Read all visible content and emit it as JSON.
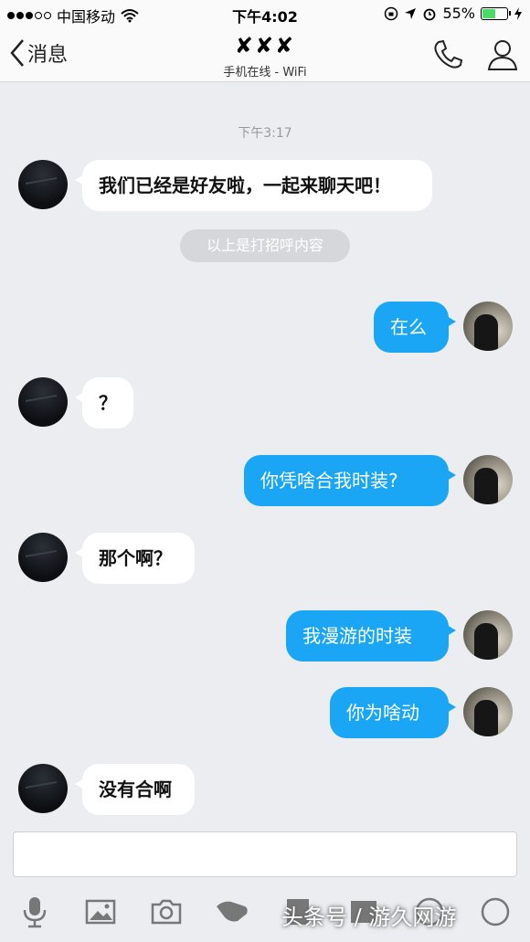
{
  "status_bar": {
    "carrier": "中国移动",
    "time": "下午4:02",
    "battery_percent": "55%",
    "battery_level": 0.55
  },
  "nav": {
    "back_label": "消息",
    "contact_name": "✘✘✘",
    "contact_status": "手机在线 - WiFi"
  },
  "chat": {
    "timestamp": "下午3:17",
    "system_notice": "以上是打招呼内容",
    "messages": [
      {
        "side": "in",
        "text": "我们已经是好友啦，一起来聊天吧！"
      },
      {
        "side": "out",
        "text": "在么"
      },
      {
        "side": "in",
        "text": "？"
      },
      {
        "side": "out",
        "text": "你凭啥合我时装?"
      },
      {
        "side": "in",
        "text": "那个啊？"
      },
      {
        "side": "out",
        "text": "我漫游的时装"
      },
      {
        "side": "out",
        "text": "你为啥动"
      },
      {
        "side": "in",
        "text": "没有合啊"
      }
    ]
  },
  "input": {
    "value": ""
  },
  "watermark": "头条号 / 游久网游",
  "colors": {
    "outgoing_bubble": "#1aa6f4",
    "incoming_bubble": "#ffffff",
    "chat_background": "#ebedf1"
  }
}
